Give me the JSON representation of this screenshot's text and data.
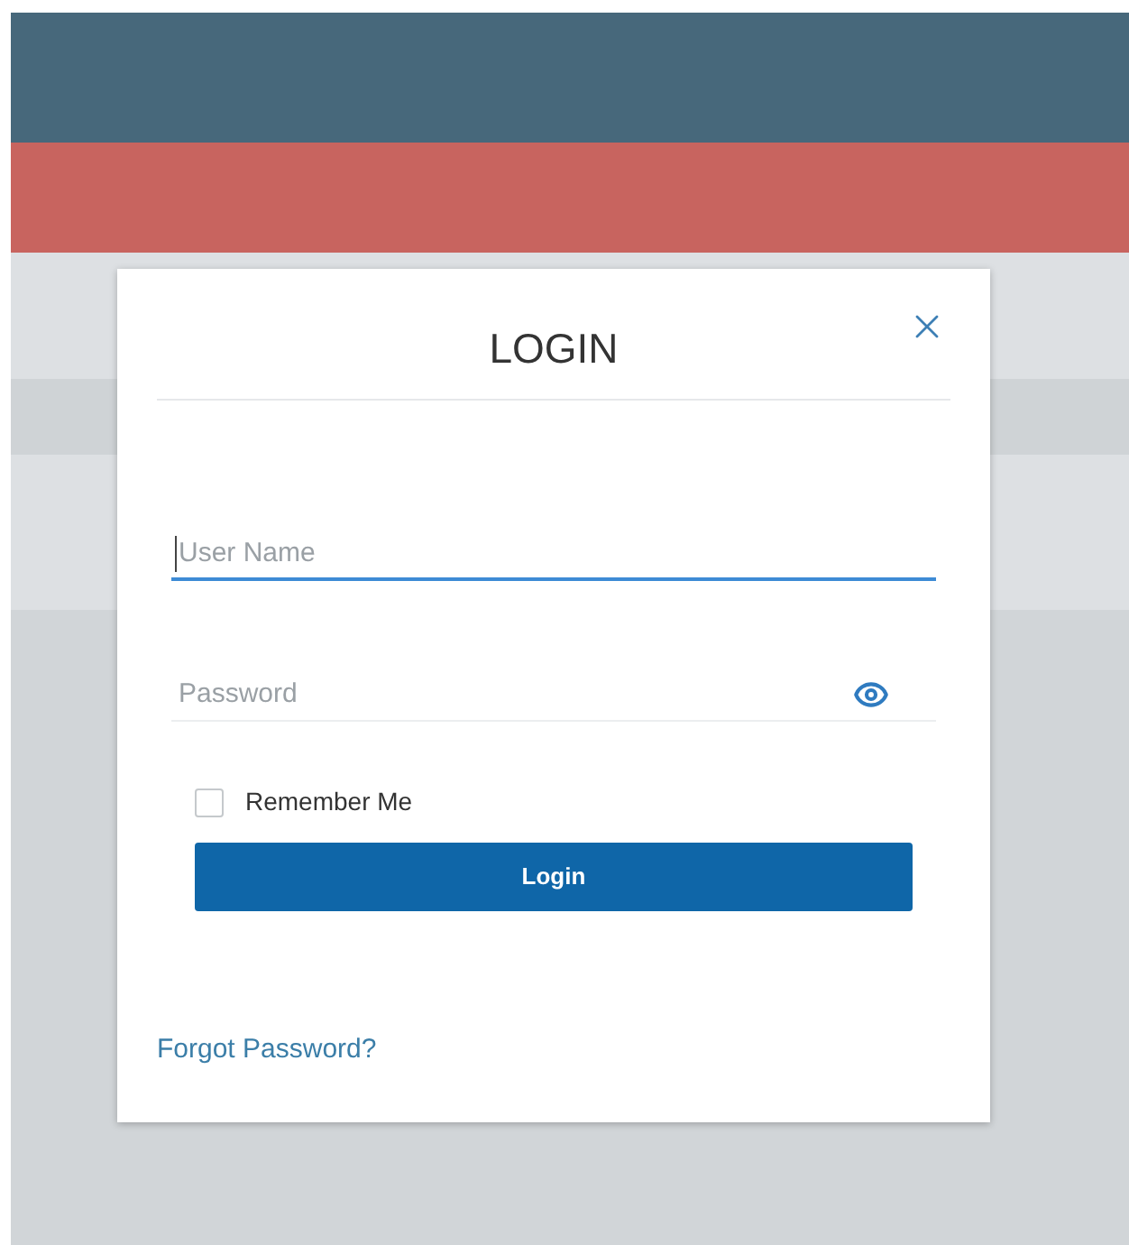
{
  "dialog": {
    "title": "LOGIN",
    "fields": [
      {
        "kind": "text",
        "placeholder": "User Name",
        "focused": true
      },
      {
        "kind": "password",
        "placeholder": "Password",
        "focused": false
      }
    ],
    "remember": {
      "label": "Remember Me",
      "checked": false
    },
    "submit": "Login",
    "forgot_link": "Forgot Password?"
  }
}
